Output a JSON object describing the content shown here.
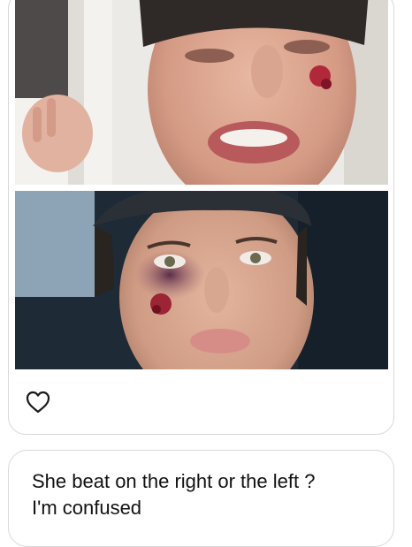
{
  "post": {
    "like_icon": "heart-outline-icon"
  },
  "comment": {
    "line1": "She beat on the right or the left ?",
    "line2": "I'm confused"
  },
  "colors": {
    "border": "#d9d9d9",
    "text": "#111111",
    "background": "#ffffff"
  }
}
